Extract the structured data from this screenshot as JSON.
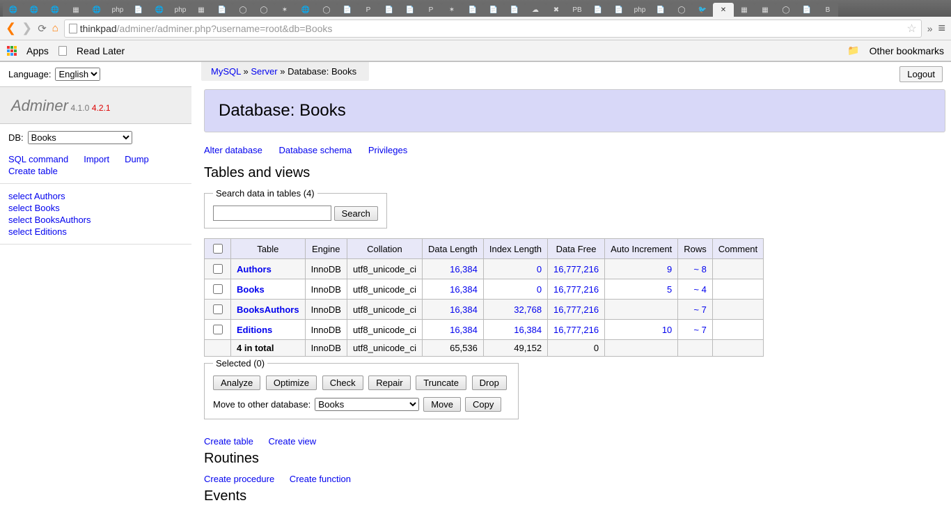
{
  "browser": {
    "url_prefix_host": "thinkpad",
    "url_path": "/adminer/adminer.php?username=root&db=Books",
    "apps_label": "Apps",
    "read_later": "Read Later",
    "other_bookmarks": "Other bookmarks"
  },
  "logout": "Logout",
  "language": {
    "label": "Language:",
    "value": "English"
  },
  "brand": {
    "name": "Adminer",
    "version": "4.1.0",
    "latest": "4.2.1"
  },
  "db_selector": {
    "label": "DB:",
    "value": "Books"
  },
  "side_links": {
    "sql": "SQL command",
    "import": "Import",
    "dump": "Dump",
    "create": "Create table"
  },
  "side_select": [
    "select Authors",
    "select Books",
    "select BooksAuthors",
    "select Editions"
  ],
  "breadcrumb": {
    "mysql": "MySQL",
    "server": "Server",
    "db_prefix": "Database: ",
    "db": "Books",
    "sep": " » "
  },
  "title": "Database: Books",
  "db_actions": {
    "alter": "Alter database",
    "schema": "Database schema",
    "priv": "Privileges"
  },
  "tables_heading": "Tables and views",
  "search": {
    "legend": "Search data in tables (4)",
    "button": "Search"
  },
  "columns": [
    "Table",
    "Engine",
    "Collation",
    "Data Length",
    "Index Length",
    "Data Free",
    "Auto Increment",
    "Rows",
    "Comment"
  ],
  "rows": [
    {
      "table": "Authors",
      "engine": "InnoDB",
      "collation": "utf8_unicode_ci",
      "data_length": "16,384",
      "index_length": "0",
      "data_free": "16,777,216",
      "auto_inc": "9",
      "rows": "~ 8",
      "comment": ""
    },
    {
      "table": "Books",
      "engine": "InnoDB",
      "collation": "utf8_unicode_ci",
      "data_length": "16,384",
      "index_length": "0",
      "data_free": "16,777,216",
      "auto_inc": "5",
      "rows": "~ 4",
      "comment": ""
    },
    {
      "table": "BooksAuthors",
      "engine": "InnoDB",
      "collation": "utf8_unicode_ci",
      "data_length": "16,384",
      "index_length": "32,768",
      "data_free": "16,777,216",
      "auto_inc": "",
      "rows": "~ 7",
      "comment": ""
    },
    {
      "table": "Editions",
      "engine": "InnoDB",
      "collation": "utf8_unicode_ci",
      "data_length": "16,384",
      "index_length": "16,384",
      "data_free": "16,777,216",
      "auto_inc": "10",
      "rows": "~ 7",
      "comment": ""
    }
  ],
  "total": {
    "label": "4 in total",
    "engine": "InnoDB",
    "collation": "utf8_unicode_ci",
    "data_length": "65,536",
    "index_length": "49,152",
    "data_free": "0",
    "auto_inc": "",
    "rows": "",
    "comment": ""
  },
  "selected": {
    "legend": "Selected (0)",
    "analyze": "Analyze",
    "optimize": "Optimize",
    "check": "Check",
    "repair": "Repair",
    "truncate": "Truncate",
    "drop": "Drop",
    "move_label": "Move to other database:",
    "move_db": "Books",
    "move": "Move",
    "copy": "Copy"
  },
  "create": {
    "table": "Create table",
    "view": "Create view"
  },
  "routines": {
    "heading": "Routines",
    "proc": "Create procedure",
    "func": "Create function"
  },
  "events": {
    "heading": "Events"
  }
}
